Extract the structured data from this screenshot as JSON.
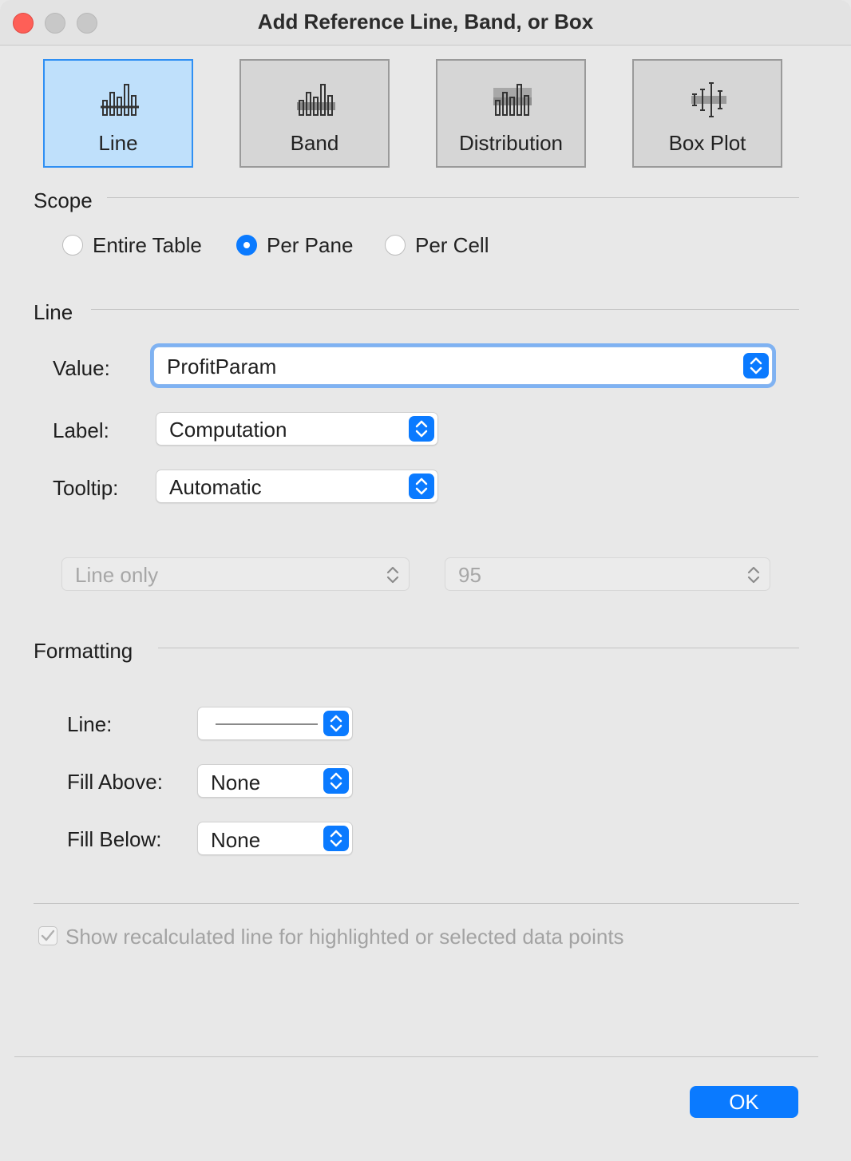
{
  "window": {
    "title": "Add Reference Line, Band, or Box"
  },
  "types": [
    {
      "label": "Line",
      "icon": "reference-line-icon",
      "selected": true
    },
    {
      "label": "Band",
      "icon": "reference-band-icon",
      "selected": false
    },
    {
      "label": "Distribution",
      "icon": "distribution-icon",
      "selected": false
    },
    {
      "label": "Box Plot",
      "icon": "box-plot-icon",
      "selected": false
    }
  ],
  "scope": {
    "heading": "Scope",
    "options": [
      {
        "label": "Entire Table",
        "selected": false
      },
      {
        "label": "Per Pane",
        "selected": true
      },
      {
        "label": "Per Cell",
        "selected": false
      }
    ]
  },
  "line": {
    "heading": "Line",
    "value_label": "Value:",
    "value": "ProfitParam",
    "label_label": "Label:",
    "label_value": "Computation",
    "tooltip_label": "Tooltip:",
    "tooltip_value": "Automatic",
    "band_mode": "Line only",
    "confidence": "95"
  },
  "formatting": {
    "heading": "Formatting",
    "line_label": "Line:",
    "fill_above_label": "Fill Above:",
    "fill_above_value": "None",
    "fill_below_label": "Fill Below:",
    "fill_below_value": "None"
  },
  "recalc": {
    "label": "Show recalculated line for highlighted or selected data points",
    "checked": true,
    "enabled": false
  },
  "ok_label": "OK",
  "colors": {
    "accent": "#0a7aff",
    "selected_tile": "#bfe0fb",
    "close": "#fe5f57"
  }
}
